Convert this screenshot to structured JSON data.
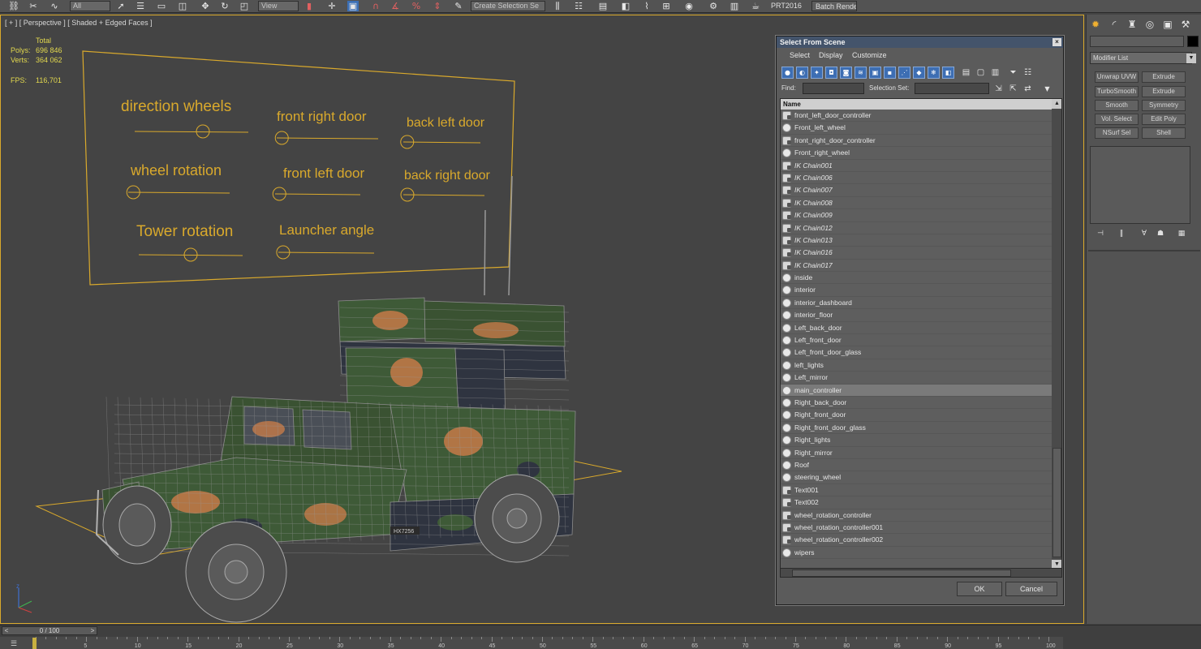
{
  "toolbar": {
    "selection_filter": "All",
    "ref_coord": "View",
    "named_selection": "Create Selection Se",
    "renderer_label": "PRT2016",
    "batch_render_label": "Batch Render..",
    "icons": [
      "link-icon",
      "unlink-icon",
      "bind-spacewarp-icon",
      "select-object-icon",
      "select-by-name-icon",
      "rect-region-icon",
      "window-crossing-icon",
      "move-icon",
      "rotate-icon",
      "scale-icon",
      "snap-icon",
      "angle-snap-icon",
      "percent-snap-icon",
      "spinner-snap-icon",
      "edit-named-sets-icon",
      "mirror-icon",
      "align-icon",
      "layer-icon",
      "graphite-icon",
      "curve-editor-icon",
      "schematic-icon",
      "material-editor-icon",
      "render-setup-icon",
      "rendered-frame-icon",
      "render-icon"
    ]
  },
  "viewport": {
    "label": "[ + ] [ Perspective ] [ Shaded + Edged Faces ]",
    "stats": {
      "header": "Total",
      "polys_label": "Polys:",
      "polys_value": "696 846",
      "verts_label": "Verts:",
      "verts_value": "364 062",
      "fps_label": "FPS:",
      "fps_value": "116,701"
    },
    "rig_panel": [
      {
        "label": "direction wheels",
        "knob": 0.6
      },
      {
        "label": "front right door",
        "knob": 0.05
      },
      {
        "label": "back left door",
        "knob": 0.05
      },
      {
        "label": "wheel rotation",
        "knob": 0.05
      },
      {
        "label": "front left door",
        "knob": 0.05
      },
      {
        "label": "back right door",
        "knob": 0.05
      },
      {
        "label": "Tower rotation",
        "knob": 0.5
      },
      {
        "label": "Launcher angle",
        "knob": 0.05
      }
    ],
    "vehicle_plate": "HX7256",
    "colors": {
      "frame": "#d9a92c",
      "text": "#d9a92c",
      "wire": "#9a9a9a",
      "camo_green": "#3e5a37",
      "camo_orange": "#c57a48",
      "camo_dark": "#2f3440"
    }
  },
  "command_panel": {
    "tabs": [
      "create-icon",
      "modify-icon",
      "hierarchy-icon",
      "motion-icon",
      "display-icon",
      "utilities-icon"
    ],
    "modifier_list": "Modifier List",
    "modifier_buttons": [
      "Unwrap UVW",
      "Extrude",
      "TurboSmooth",
      "Symmetry",
      "Smooth",
      "Edit Poly",
      "Vol. Select",
      "Shell",
      "NSurf Sel"
    ],
    "stack_icons": [
      "pin-stack-icon",
      "show-end-result-icon",
      "make-unique-icon",
      "remove-modifier-icon",
      "configure-sets-icon"
    ]
  },
  "dialog": {
    "title": "Select From Scene",
    "close": "×",
    "menus": [
      "Select",
      "Display",
      "Customize"
    ],
    "find_label": "Find:",
    "selection_set_label": "Selection Set:",
    "column_header": "Name",
    "rows": [
      {
        "name": "front_left_door_controller",
        "kind": "helper",
        "italic": false
      },
      {
        "name": "Front_left_wheel",
        "kind": "geometry",
        "italic": false
      },
      {
        "name": "front_right_door_controller",
        "kind": "helper",
        "italic": false
      },
      {
        "name": "Front_right_wheel",
        "kind": "geometry",
        "italic": false
      },
      {
        "name": "IK Chain001",
        "kind": "helper",
        "italic": true
      },
      {
        "name": "IK Chain006",
        "kind": "helper",
        "italic": true
      },
      {
        "name": "IK Chain007",
        "kind": "helper",
        "italic": true
      },
      {
        "name": "IK Chain008",
        "kind": "helper",
        "italic": true
      },
      {
        "name": "IK Chain009",
        "kind": "helper",
        "italic": true
      },
      {
        "name": "IK Chain012",
        "kind": "helper",
        "italic": true
      },
      {
        "name": "IK Chain013",
        "kind": "helper",
        "italic": true
      },
      {
        "name": "IK Chain016",
        "kind": "helper",
        "italic": true
      },
      {
        "name": "IK Chain017",
        "kind": "helper",
        "italic": true
      },
      {
        "name": "inside",
        "kind": "geometry",
        "italic": false
      },
      {
        "name": "interior",
        "kind": "geometry",
        "italic": false
      },
      {
        "name": "interior_dashboard",
        "kind": "geometry",
        "italic": false
      },
      {
        "name": "interior_floor",
        "kind": "geometry",
        "italic": false
      },
      {
        "name": "Left_back_door",
        "kind": "geometry",
        "italic": false
      },
      {
        "name": "Left_front_door",
        "kind": "geometry",
        "italic": false
      },
      {
        "name": "Left_front_door_glass",
        "kind": "geometry",
        "italic": false
      },
      {
        "name": "left_lights",
        "kind": "geometry",
        "italic": false
      },
      {
        "name": "Left_mirror",
        "kind": "geometry",
        "italic": false
      },
      {
        "name": "main_controller",
        "kind": "geometry",
        "italic": false,
        "selected": true
      },
      {
        "name": "Right_back_door",
        "kind": "geometry",
        "italic": false
      },
      {
        "name": "Right_front_door",
        "kind": "geometry",
        "italic": false
      },
      {
        "name": "Right_front_door_glass",
        "kind": "geometry",
        "italic": false
      },
      {
        "name": "Right_lights",
        "kind": "geometry",
        "italic": false
      },
      {
        "name": "Right_mirror",
        "kind": "geometry",
        "italic": false
      },
      {
        "name": "Roof",
        "kind": "geometry",
        "italic": false
      },
      {
        "name": "steering_wheel",
        "kind": "geometry",
        "italic": false
      },
      {
        "name": "Text001",
        "kind": "helper",
        "italic": false
      },
      {
        "name": "Text002",
        "kind": "helper",
        "italic": false
      },
      {
        "name": "wheel_rotation_controller",
        "kind": "helper",
        "italic": false
      },
      {
        "name": "wheel_rotation_controller001",
        "kind": "helper",
        "italic": false
      },
      {
        "name": "wheel_rotation_controller002",
        "kind": "helper",
        "italic": false
      },
      {
        "name": "wipers",
        "kind": "geometry",
        "italic": false
      }
    ],
    "ok_label": "OK",
    "cancel_label": "Cancel"
  },
  "timeline": {
    "frame_readout": "0 / 100",
    "ticks": [
      "0",
      "5",
      "10",
      "15",
      "20",
      "25",
      "30",
      "35",
      "40",
      "45",
      "50",
      "55",
      "60",
      "65",
      "70",
      "75",
      "80",
      "85",
      "90",
      "95",
      "100"
    ],
    "key_color": "#c8b040"
  }
}
